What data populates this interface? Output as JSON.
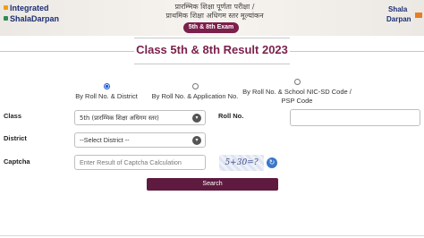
{
  "header": {
    "logo_left_line1": "Integrated",
    "logo_left_line2": "ShalaDarpan",
    "logo_right_line1": "Shala",
    "logo_right_line2": "Darpan",
    "hindi_line1": "प्रारम्भिक शिक्षा पूर्णता परीक्षा /",
    "hindi_line2": "प्राथमिक शिक्षा अधिगम स्तर मूल्यांकन",
    "exam_badge": "5th & 8th Exam"
  },
  "page_title": "Class 5th & 8th Result 2023",
  "search_modes": [
    {
      "label": "By Roll No. & District",
      "checked": true
    },
    {
      "label": "By Roll No. & Application No.",
      "checked": false
    },
    {
      "label": "By Roll No. & School NIC-SD Code / PSP Code",
      "checked": false
    }
  ],
  "form": {
    "class_label": "Class",
    "class_value": "5th (प्रारम्भिक शिक्षा अधिगम स्तर)",
    "roll_label": "Roll No.",
    "roll_value": "",
    "district_label": "District",
    "district_value": "--Select District --",
    "captcha_label": "Captcha",
    "captcha_placeholder": "Enter Result of Captcha Calculation",
    "captcha_text": "5+30=?",
    "search_label": "Search"
  },
  "colors": {
    "brand": "#7b1f4b",
    "button": "#5f1b3f",
    "radio_active": "#1e5fd6"
  }
}
